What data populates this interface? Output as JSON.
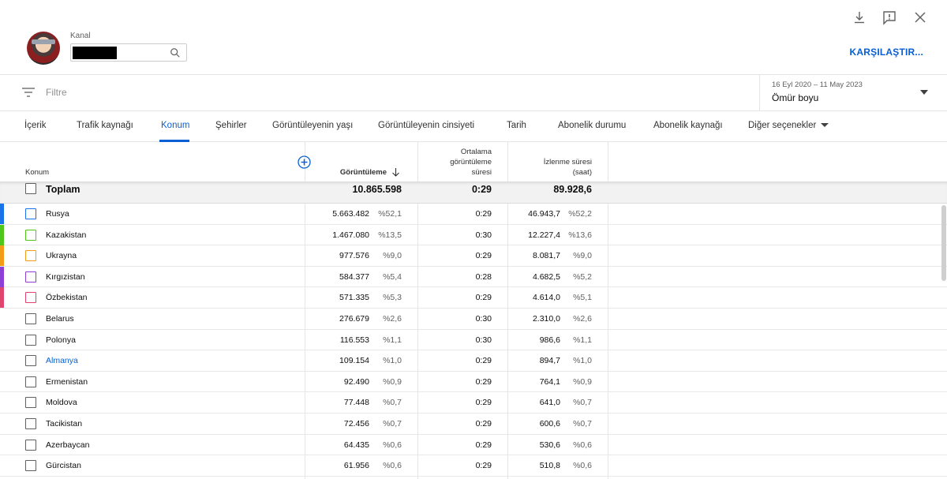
{
  "header": {
    "channel_label": "Kanal",
    "compare_label": "KARŞILAŞTIR..."
  },
  "filter": {
    "placeholder": "Filtre"
  },
  "date": {
    "range": "16 Eyl 2020 – 11 May 2023",
    "value": "Ömür boyu"
  },
  "tabs": [
    {
      "label": "İçerik"
    },
    {
      "label": "Trafik kaynağı"
    },
    {
      "label": "Konum"
    },
    {
      "label": "Şehirler"
    },
    {
      "label": "Görüntüleyenin yaşı"
    },
    {
      "label": "Görüntüleyenin cinsiyeti"
    },
    {
      "label": "Tarih"
    },
    {
      "label": "Abonelik durumu"
    },
    {
      "label": "Abonelik kaynağı"
    },
    {
      "label": "Diğer seçenekler"
    }
  ],
  "table": {
    "headers": {
      "location": "Konum",
      "views": "Görüntüleme",
      "avg_line1": "Ortalama",
      "avg_line2": "görüntüleme",
      "avg_line3": "süresi",
      "watch_line1": "İzlenme süresi",
      "watch_line2": "(saat)"
    },
    "total": {
      "label": "Toplam",
      "views": "10.865.598",
      "avg": "0:29",
      "watch": "89.928,6"
    },
    "rows": [
      {
        "name": "Rusya",
        "views": "5.663.482",
        "views_pct": "%52,1",
        "avg": "0:29",
        "watch": "46.943,7",
        "watch_pct": "%52,2",
        "color": "#1a73e8"
      },
      {
        "name": "Kazakistan",
        "views": "1.467.080",
        "views_pct": "%13,5",
        "avg": "0:30",
        "watch": "12.227,4",
        "watch_pct": "%13,6",
        "color": "#4fc61b"
      },
      {
        "name": "Ukrayna",
        "views": "977.576",
        "views_pct": "%9,0",
        "avg": "0:29",
        "watch": "8.081,7",
        "watch_pct": "%9,0",
        "color": "#f29d18"
      },
      {
        "name": "Kırgızistan",
        "views": "584.377",
        "views_pct": "%5,4",
        "avg": "0:28",
        "watch": "4.682,5",
        "watch_pct": "%5,2",
        "color": "#8e3fd6"
      },
      {
        "name": "Özbekistan",
        "views": "571.335",
        "views_pct": "%5,3",
        "avg": "0:29",
        "watch": "4.614,0",
        "watch_pct": "%5,1",
        "color": "#e0456f"
      },
      {
        "name": "Belarus",
        "views": "276.679",
        "views_pct": "%2,6",
        "avg": "0:30",
        "watch": "2.310,0",
        "watch_pct": "%2,6",
        "color": ""
      },
      {
        "name": "Polonya",
        "views": "116.553",
        "views_pct": "%1,1",
        "avg": "0:30",
        "watch": "986,6",
        "watch_pct": "%1,1",
        "color": ""
      },
      {
        "name": "Almanya",
        "views": "109.154",
        "views_pct": "%1,0",
        "avg": "0:29",
        "watch": "894,7",
        "watch_pct": "%1,0",
        "color": "",
        "link": true
      },
      {
        "name": "Ermenistan",
        "views": "92.490",
        "views_pct": "%0,9",
        "avg": "0:29",
        "watch": "764,1",
        "watch_pct": "%0,9",
        "color": ""
      },
      {
        "name": "Moldova",
        "views": "77.448",
        "views_pct": "%0,7",
        "avg": "0:29",
        "watch": "641,0",
        "watch_pct": "%0,7",
        "color": ""
      },
      {
        "name": "Tacikistan",
        "views": "72.456",
        "views_pct": "%0,7",
        "avg": "0:29",
        "watch": "600,6",
        "watch_pct": "%0,7",
        "color": ""
      },
      {
        "name": "Azerbaycan",
        "views": "64.435",
        "views_pct": "%0,6",
        "avg": "0:29",
        "watch": "530,6",
        "watch_pct": "%0,6",
        "color": ""
      },
      {
        "name": "Gürcistan",
        "views": "61.956",
        "views_pct": "%0,6",
        "avg": "0:29",
        "watch": "510,8",
        "watch_pct": "%0,6",
        "color": ""
      }
    ]
  }
}
